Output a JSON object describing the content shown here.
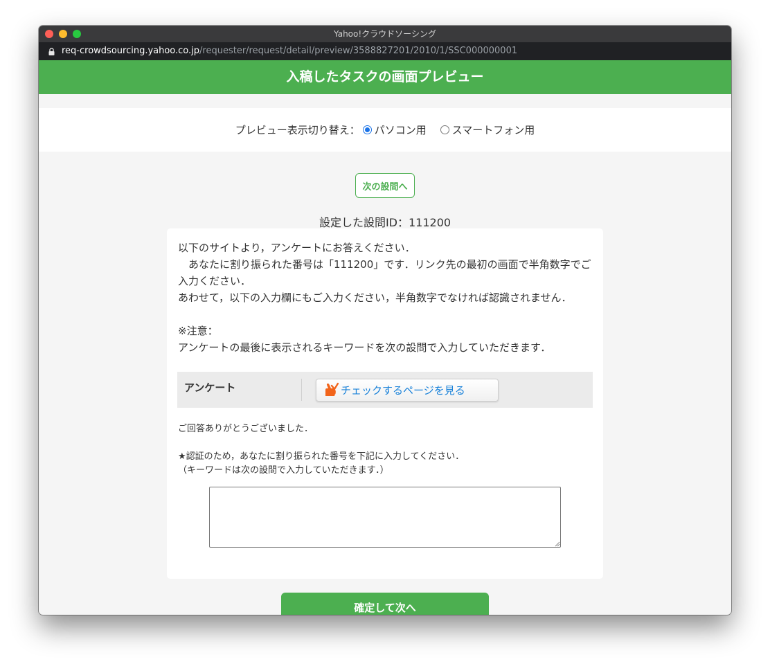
{
  "window": {
    "title": "Yahoo!クラウドソーシング",
    "url_host": "req-crowdsourcing.yahoo.co.jp",
    "url_path": "/requester/request/detail/preview/3588827201/2010/1/SSC000000001"
  },
  "header": {
    "title": "入稿したタスクの画面プレビュー"
  },
  "preview_switch": {
    "label": "プレビュー表示切り替え：",
    "options": [
      {
        "label": "パソコン用",
        "checked": true
      },
      {
        "label": "スマートフォン用",
        "checked": false
      }
    ]
  },
  "next_question_button": "次の設問へ",
  "question_id_label": "設定した設問ID：111200",
  "card": {
    "instructions": "以下のサイトより，アンケートにお答えください．\n　あなたに割り振られた番号は「111200」です．リンク先の最初の画面で半角数字でご入力ください．\nあわせて，以下の入力欄にもご入力ください，半角数字でなければ認識されません．\n\n※注意：\nアンケートの最後に表示されるキーワードを次の設問で入力していただきます．",
    "survey_label": "アンケート",
    "check_page_button": "チェックするページを見る",
    "thanks": "ご回答ありがとうございました．",
    "auth_note": "★認証のため，あなたに割り振られた番号を下記に入力してください．\n（キーワードは次の設問で入力していただきます．）",
    "answer_value": ""
  },
  "submit_button": "確定して次へ",
  "colors": {
    "accent": "#4caf50",
    "link": "#1a82d9",
    "radio": "#1a73e8"
  },
  "icons": [
    "lock-icon",
    "hand-check-icon"
  ]
}
